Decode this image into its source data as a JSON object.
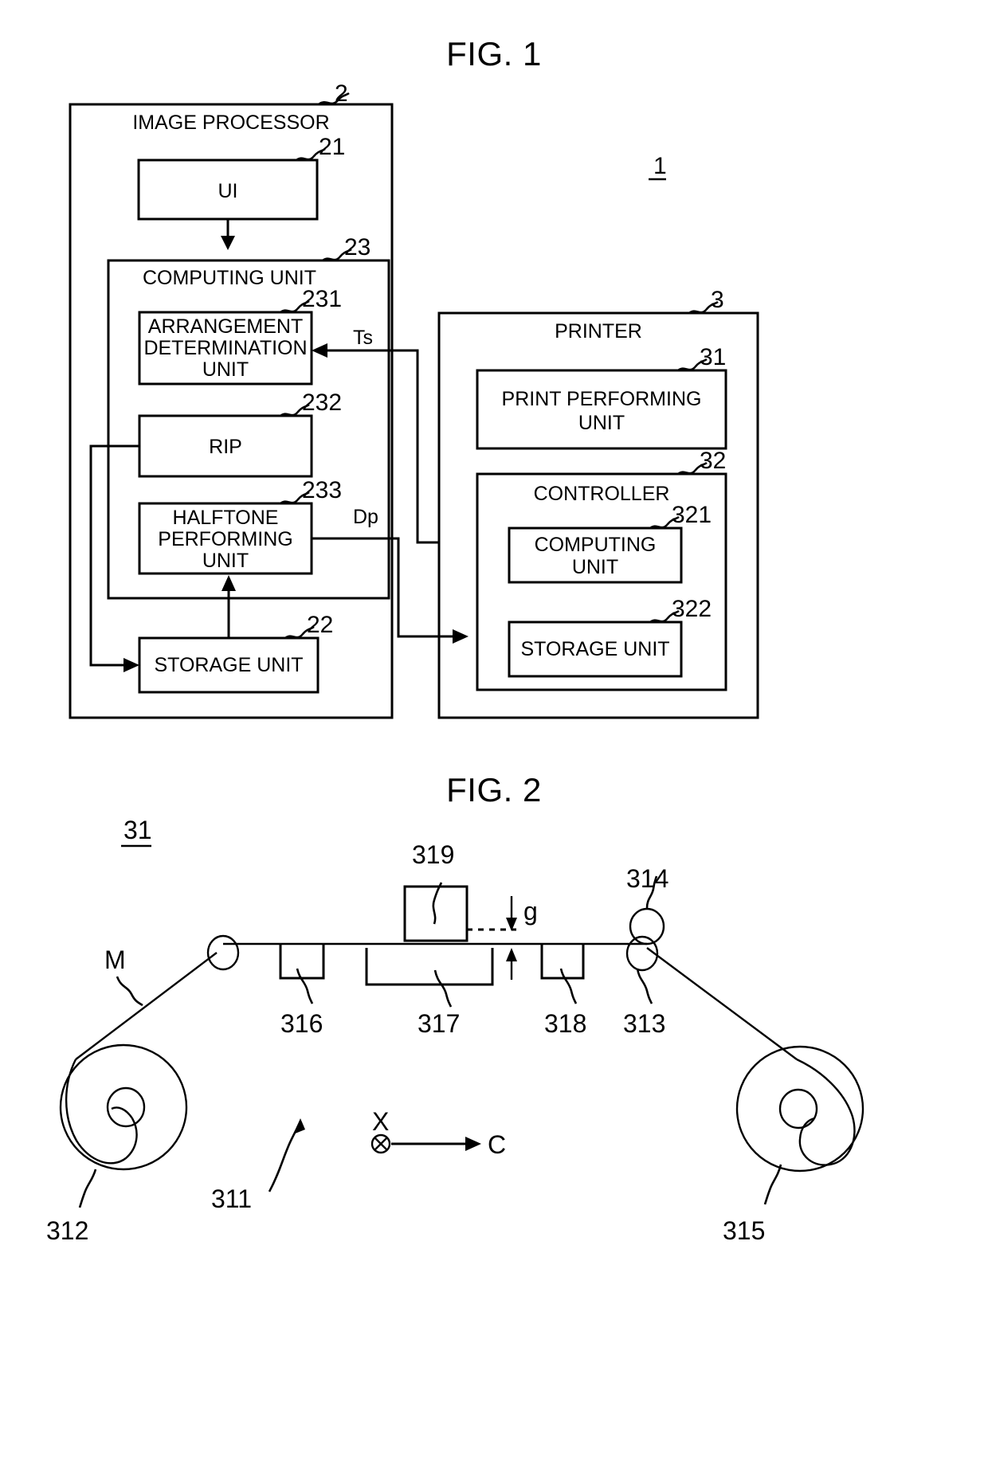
{
  "document": {
    "type": "patent-drawing-sheet",
    "background": "#ffffff",
    "ink": "#000000"
  },
  "figures": [
    {
      "id": "fig1",
      "title": "FIG. 1",
      "system_ref": "1",
      "blocks": [
        {
          "ref": "2",
          "label": "IMAGE PROCESSOR"
        },
        {
          "ref": "21",
          "label": "UI"
        },
        {
          "ref": "23",
          "label": "COMPUTING UNIT"
        },
        {
          "ref": "231",
          "label": "ARRANGEMENT DETERMINATION UNIT"
        },
        {
          "ref": "232",
          "label": "RIP"
        },
        {
          "ref": "233",
          "label": "HALFTONE PERFORMING UNIT"
        },
        {
          "ref": "22",
          "label": "STORAGE UNIT"
        },
        {
          "ref": "3",
          "label": "PRINTER"
        },
        {
          "ref": "31",
          "label": "PRINT PERFORMING UNIT"
        },
        {
          "ref": "32",
          "label": "CONTROLLER"
        },
        {
          "ref": "321",
          "label": "COMPUTING UNIT"
        },
        {
          "ref": "322",
          "label": "STORAGE UNIT"
        }
      ],
      "signals": [
        {
          "name": "Ts",
          "from": "printer",
          "to": "arrangement-determination-unit"
        },
        {
          "name": "Dp",
          "from": "halftone-performing-unit",
          "to": "controller-storage-unit"
        }
      ]
    },
    {
      "id": "fig2",
      "title": "FIG. 2",
      "assembly_ref": "31",
      "parts": [
        {
          "ref": "311",
          "name": "print-performing-assembly"
        },
        {
          "ref": "312",
          "name": "supply-roll"
        },
        {
          "ref": "313",
          "name": "lower-nip-roller"
        },
        {
          "ref": "314",
          "name": "upper-nip-roller"
        },
        {
          "ref": "315",
          "name": "take-up-roll"
        },
        {
          "ref": "316",
          "name": "guide-block-left"
        },
        {
          "ref": "317",
          "name": "platen"
        },
        {
          "ref": "318",
          "name": "guide-block-right"
        },
        {
          "ref": "319",
          "name": "print-head"
        }
      ],
      "annotations": [
        {
          "name": "M",
          "meaning": "web-medium"
        },
        {
          "name": "g",
          "meaning": "gap"
        },
        {
          "name": "X",
          "meaning": "x-axis-into-page"
        },
        {
          "name": "C",
          "meaning": "conveyance-direction"
        }
      ]
    }
  ],
  "fig1_text": {
    "title": "FIG. 1",
    "system_ref": "1",
    "image_processor": {
      "ref": "2",
      "label": "IMAGE PROCESSOR"
    },
    "ui": {
      "ref": "21",
      "label": "UI"
    },
    "computing_unit": {
      "ref": "23",
      "label": "COMPUTING UNIT"
    },
    "arrangement_unit": {
      "ref": "231",
      "line1": "ARRANGEMENT",
      "line2": "DETERMINATION",
      "line3": "UNIT"
    },
    "rip": {
      "ref": "232",
      "label": "RIP"
    },
    "halftone_unit": {
      "ref": "233",
      "line1": "HALFTONE",
      "line2": "PERFORMING",
      "line3": "UNIT"
    },
    "storage_unit": {
      "ref": "22",
      "label": "STORAGE UNIT"
    },
    "printer": {
      "ref": "3",
      "label": "PRINTER"
    },
    "print_performing_unit": {
      "ref": "31",
      "line1": "PRINT PERFORMING",
      "line2": "UNIT"
    },
    "controller": {
      "ref": "32",
      "label": "CONTROLLER"
    },
    "ctrl_computing_unit": {
      "ref": "321",
      "line1": "COMPUTING",
      "line2": "UNIT"
    },
    "ctrl_storage_unit": {
      "ref": "322",
      "label": "STORAGE UNIT"
    },
    "signal_ts": "Ts",
    "signal_dp": "Dp"
  },
  "fig2_text": {
    "title": "FIG. 2",
    "assembly_ref": "31",
    "ref_311": "311",
    "ref_312": "312",
    "ref_313": "313",
    "ref_314": "314",
    "ref_315": "315",
    "ref_316": "316",
    "ref_317": "317",
    "ref_318": "318",
    "ref_319": "319",
    "label_M": "M",
    "label_g": "g",
    "label_X": "X",
    "label_C": "C"
  }
}
